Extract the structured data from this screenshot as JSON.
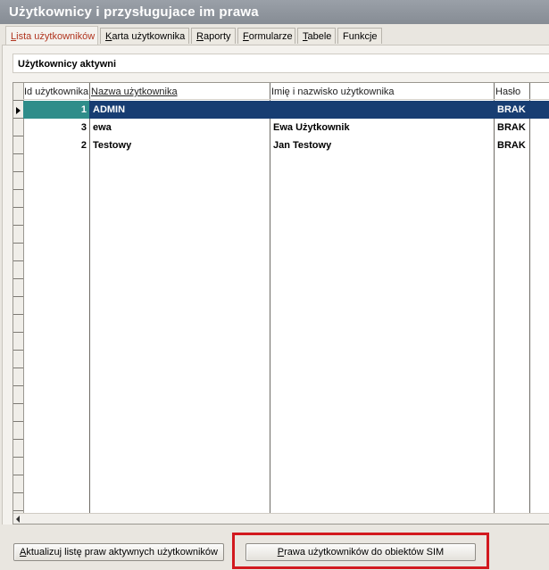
{
  "window": {
    "title": "Użytkownicy i przysługujace im prawa"
  },
  "tabs": [
    {
      "key": "L",
      "rest": "ista użytkowników",
      "active": true
    },
    {
      "key": "K",
      "rest": "arta użytkownika"
    },
    {
      "key": "R",
      "rest": "aporty"
    },
    {
      "key": "F",
      "rest": "ormularze"
    },
    {
      "key": "T",
      "rest": "abele"
    },
    {
      "key": "Fu",
      "rest": "nkcje"
    }
  ],
  "section": {
    "title": "Użytkownicy aktywni"
  },
  "table": {
    "headers": [
      "Id użytkownika",
      "Nazwa użytkownika",
      "Imię i nazwisko użytkownika",
      "Hasło"
    ],
    "rows": [
      {
        "id": "1",
        "name": "ADMIN",
        "full_name": "",
        "password": "BRAK",
        "selected": true
      },
      {
        "id": "3",
        "name": "ewa",
        "full_name": "Ewa Użytkownik",
        "password": "BRAK"
      },
      {
        "id": "2",
        "name": "Testowy",
        "full_name": "Jan Testowy",
        "password": "BRAK"
      }
    ]
  },
  "buttons": {
    "update_key": "A",
    "update_rest": "ktualizuj listę praw aktywnych użytkowników",
    "rights_key": "P",
    "rights_rest": "rawa użytkowników do obiektów SIM"
  },
  "colors": {
    "selection": "#173d72",
    "selection_id": "#2f8d8a",
    "highlight_border": "#d2191e",
    "active_tab_text": "#b0341e"
  }
}
